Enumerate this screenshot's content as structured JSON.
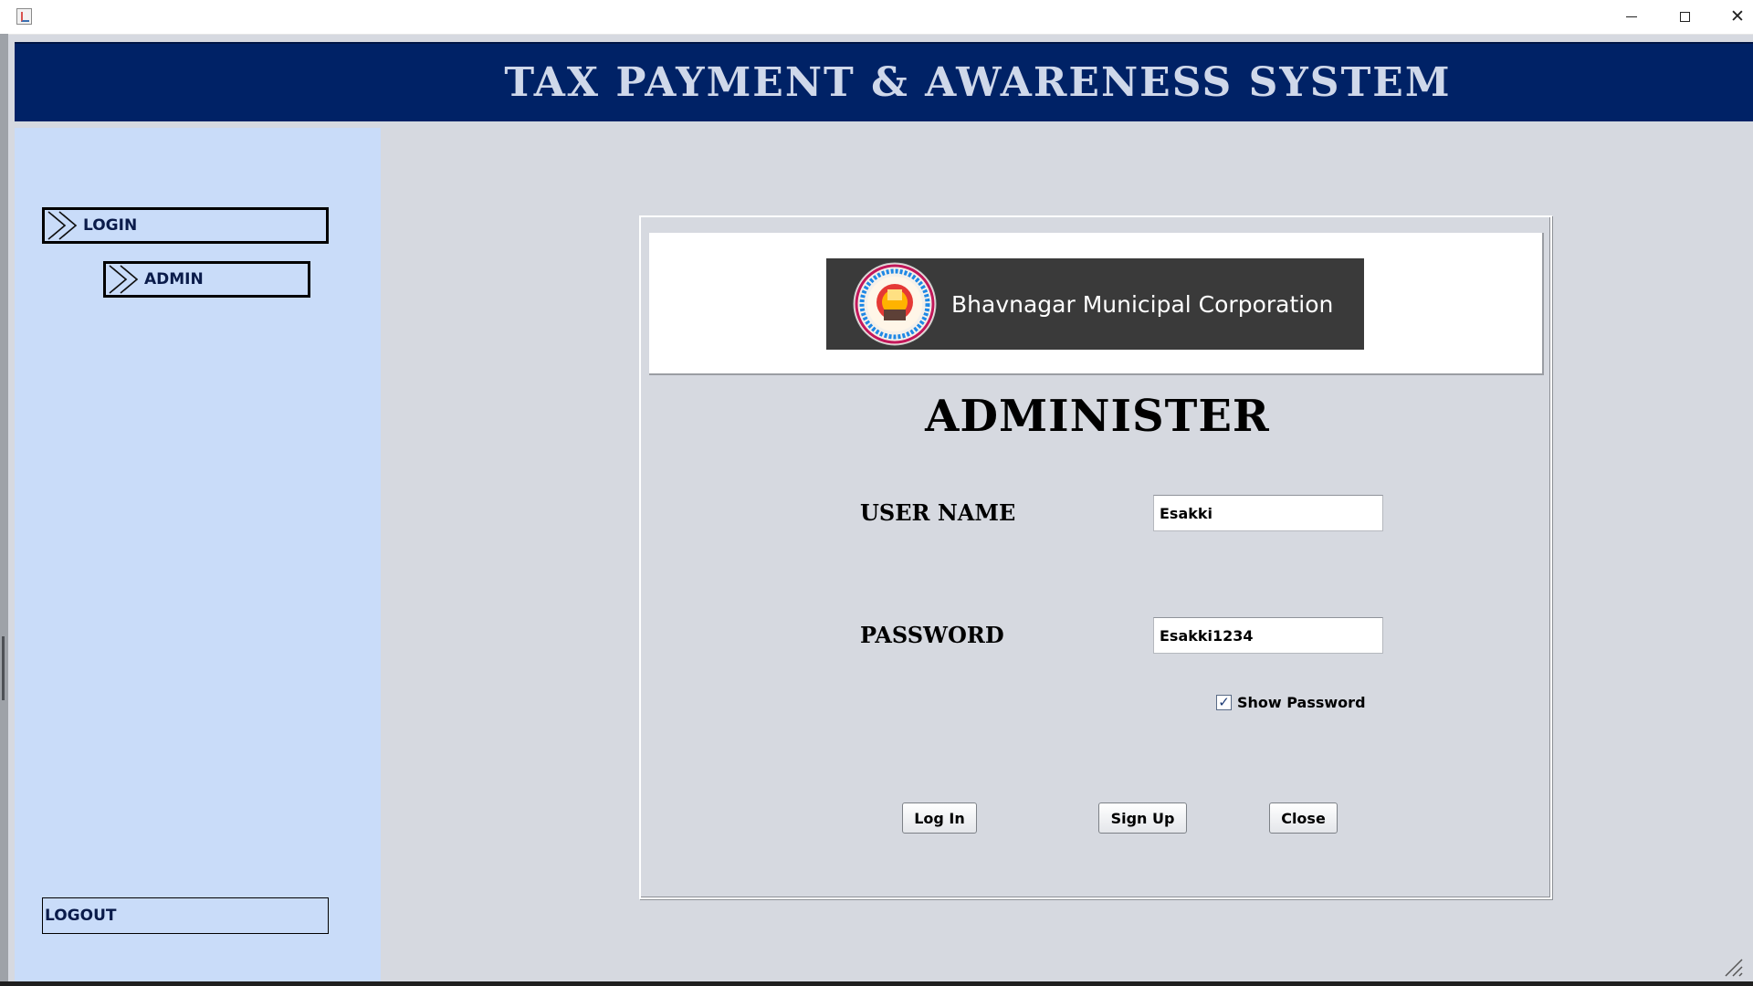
{
  "window": {
    "title": "",
    "controls": {
      "minimize_icon": "minimize-icon",
      "maximize_icon": "maximize-icon",
      "close_icon": "close-icon"
    }
  },
  "banner": {
    "title": "TAX PAYMENT & AWARENESS SYSTEM"
  },
  "sidebar": {
    "items": [
      {
        "label": "LOGIN",
        "icon": "double-chevron-right-icon"
      },
      {
        "label": "ADMIN",
        "icon": "double-chevron-right-icon"
      }
    ],
    "logout_label": "LOGOUT"
  },
  "logo": {
    "org_name": "Bhavnagar Municipal Corporation"
  },
  "form": {
    "heading": "ADMINISTER",
    "username_label": "USER NAME",
    "username_value": "Esakki",
    "password_label": "PASSWORD",
    "password_value": "Esakki1234",
    "show_password_label": "Show Password",
    "show_password_checked": true
  },
  "buttons": {
    "login": "Log In",
    "signup": "Sign Up",
    "close": "Close"
  },
  "colors": {
    "banner_bg": "#002266",
    "banner_text": "#cfd8ea",
    "sidebar_bg": "#c9dcf9",
    "content_bg": "#d6d9e0",
    "logo_strip_bg": "#3a3a3a"
  }
}
